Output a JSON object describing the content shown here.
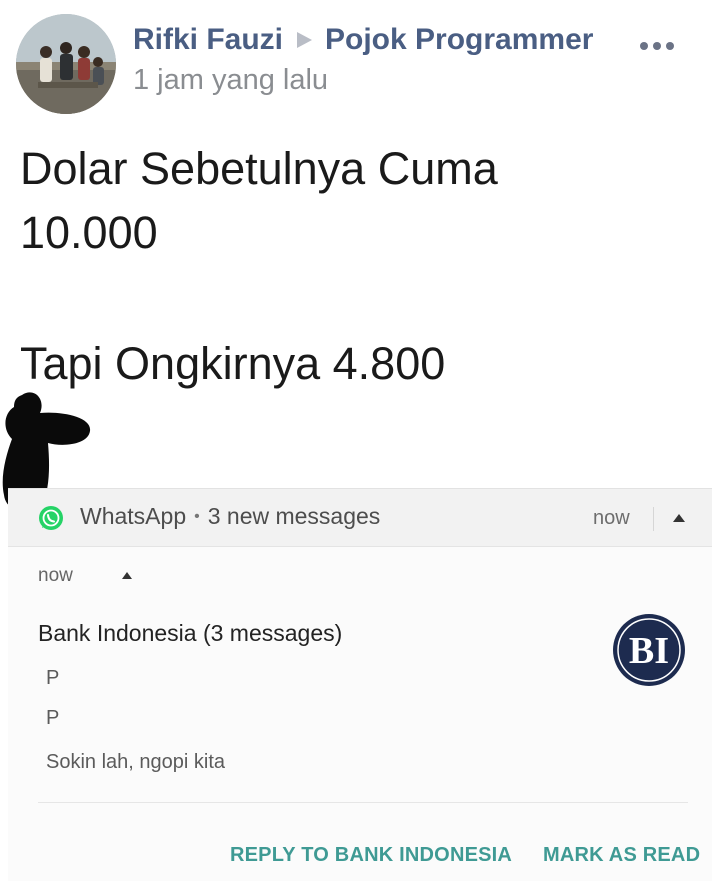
{
  "post": {
    "author": "Rifki Fauzi",
    "group": "Pojok Programmer",
    "time": "1 jam yang lalu",
    "text_lines": [
      "Dolar Sebetulnya Cuma",
      "10.000",
      "Tapi Ongkirnya 4.800"
    ]
  },
  "icons": {
    "more": "more-horizontal-icon",
    "arrow": "triangle-right-icon",
    "whatsapp": "whatsapp-icon",
    "caret": "caret-up-icon",
    "bank_logo": "bank-indonesia-logo-icon"
  },
  "notification": {
    "app": "WhatsApp",
    "separator": "•",
    "summary": "3 new messages",
    "time": "now",
    "sub_time": "now",
    "conversation": "Bank Indonesia (3 messages)",
    "messages": [
      "P",
      "P",
      "Sokin lah, ngopi kita"
    ],
    "logo_text": "BI",
    "actions": [
      "REPLY TO BANK INDONESIA",
      "MARK AS READ"
    ]
  },
  "colors": {
    "author": "#4a5e83",
    "action": "#3f9a94",
    "whatsapp": "#25d366",
    "logo": "#1d2b4f"
  }
}
